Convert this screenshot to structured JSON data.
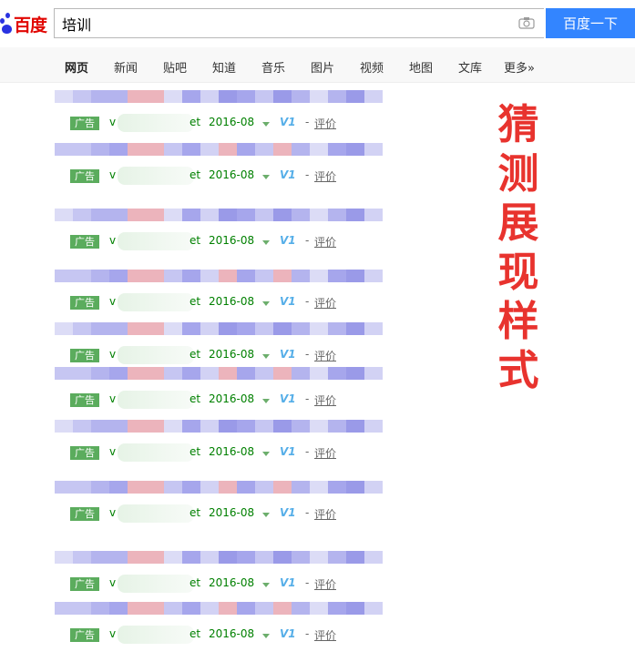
{
  "header": {
    "logo_text": "百度",
    "search_value": "培训",
    "search_button_label": "百度一下",
    "camera_icon": "camera-icon"
  },
  "nav": {
    "items": [
      {
        "label": "网页",
        "active": true
      },
      {
        "label": "新闻"
      },
      {
        "label": "贴吧"
      },
      {
        "label": "知道"
      },
      {
        "label": "音乐"
      },
      {
        "label": "图片"
      },
      {
        "label": "视频"
      },
      {
        "label": "地图"
      },
      {
        "label": "文库"
      },
      {
        "label": "更多»"
      }
    ]
  },
  "results": [
    {
      "ad_label": "广告",
      "url_prefix": "v",
      "url_suffix": "et",
      "date": "2016-08",
      "v_badge": "V1",
      "separator": "-",
      "review_label": "评价"
    },
    {
      "ad_label": "广告",
      "url_prefix": "v",
      "url_suffix": "et",
      "date": "2016-08",
      "v_badge": "V1",
      "separator": "-",
      "review_label": "评价"
    },
    {
      "ad_label": "广告",
      "url_prefix": "v",
      "url_suffix": "et",
      "date": "2016-08",
      "v_badge": "V1",
      "separator": "-",
      "review_label": "评价"
    },
    {
      "ad_label": "广告",
      "url_prefix": "v",
      "url_suffix": "et",
      "date": "2016-08",
      "v_badge": "V1",
      "separator": "-",
      "review_label": "评价"
    },
    {
      "ad_label": "广告",
      "url_prefix": "v",
      "url_suffix": "et",
      "date": "2016-08",
      "v_badge": "V1",
      "separator": "-",
      "review_label": "评价"
    },
    {
      "ad_label": "广告",
      "url_prefix": "v",
      "url_suffix": "et",
      "date": "2016-08",
      "v_badge": "V1",
      "separator": "-",
      "review_label": "评价"
    },
    {
      "ad_label": "广告",
      "url_prefix": "v",
      "url_suffix": "et",
      "date": "2016-08",
      "v_badge": "V1",
      "separator": "-",
      "review_label": "评价"
    },
    {
      "ad_label": "广告",
      "url_prefix": "v",
      "url_suffix": "et",
      "date": "2016-08",
      "v_badge": "V1",
      "separator": "-",
      "review_label": "评价"
    },
    {
      "ad_label": "广告",
      "url_prefix": "v",
      "url_suffix": "et",
      "date": "2016-08",
      "v_badge": "V1",
      "separator": "-",
      "review_label": "评价"
    },
    {
      "ad_label": "广告",
      "url_prefix": "v",
      "url_suffix": "et",
      "date": "2016-08",
      "v_badge": "V1",
      "separator": "-",
      "review_label": "评价"
    }
  ],
  "watermark": {
    "text": "猜\n测\n展\n现\n样\n式",
    "color": "#e8332e"
  },
  "colors": {
    "accent": "#3385ff",
    "url_green": "#008000",
    "ad_badge": "#5bac5d",
    "mosaic_palette": [
      "#dcdcf6",
      "#c6c6f2",
      "#b4b4ee",
      "#a6a6ec",
      "#9a9ae8",
      "#ecb4bc",
      "#d2d2f4",
      "#b8b8f0"
    ]
  }
}
